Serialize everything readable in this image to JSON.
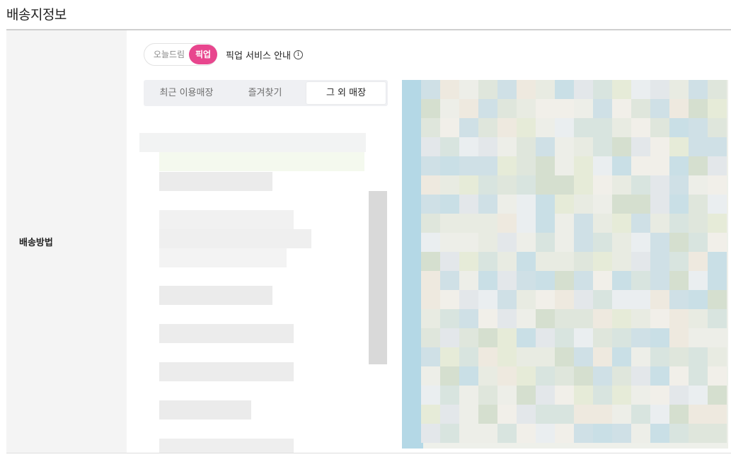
{
  "section": {
    "title": "배송지정보"
  },
  "delivery": {
    "label": "배송방법",
    "toggle": {
      "options": [
        "오늘드림",
        "픽업"
      ],
      "selected": "픽업",
      "selected_color": "#e8468e"
    },
    "pickup_info": {
      "label": "픽업 서비스 안내",
      "icon": "info-icon"
    },
    "tabs": [
      {
        "label": "최근 이용매장",
        "active": false
      },
      {
        "label": "즐겨찾기",
        "active": false
      },
      {
        "label": "그 외 매장",
        "active": true
      }
    ]
  }
}
